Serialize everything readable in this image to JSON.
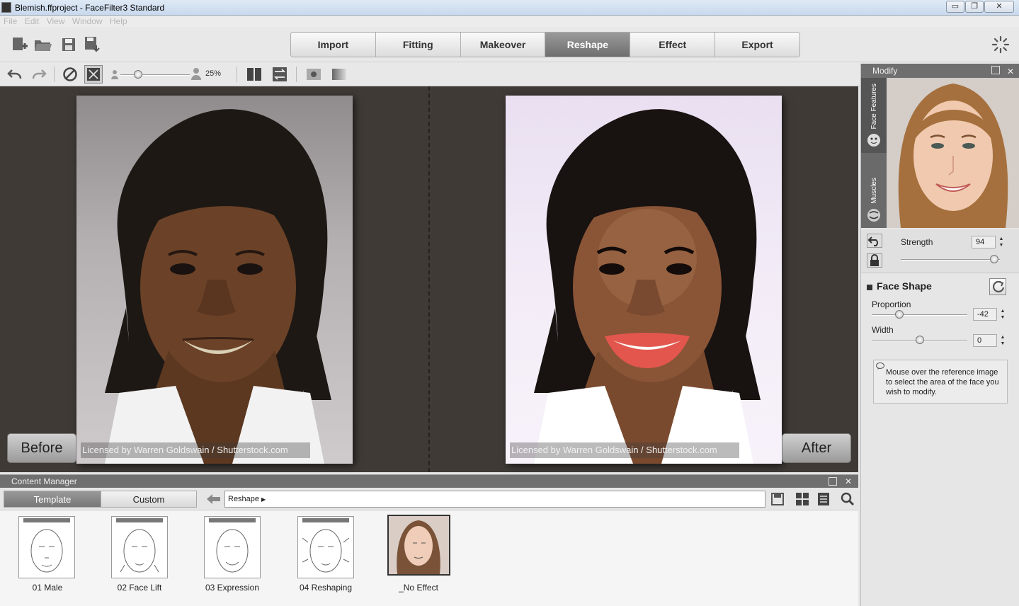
{
  "window": {
    "title": "Blemish.ffproject - FaceFilter3 Standard",
    "minimize": "▭",
    "restore": "❐",
    "close": "✕"
  },
  "menu": [
    "File",
    "Edit",
    "View",
    "Window",
    "Help"
  ],
  "tabs": [
    {
      "label": "Import"
    },
    {
      "label": "Fitting"
    },
    {
      "label": "Makeover"
    },
    {
      "label": "Reshape",
      "active": true
    },
    {
      "label": "Effect"
    },
    {
      "label": "Export"
    }
  ],
  "toolbar": {
    "zoom": "25%",
    "zoom_level": 0.25
  },
  "viewer": {
    "before_label": "Before",
    "after_label": "After",
    "watermark": "Licensed by Warren Goldswain / Shutterstock.com"
  },
  "modify": {
    "title": "Modify",
    "tab_face_features": "Face Features",
    "tab_muscles": "Muscles",
    "strength_label": "Strength",
    "strength_value": "94",
    "strength_level": 0.94
  },
  "face_shape": {
    "title": "Face Shape",
    "params": [
      {
        "label": "Proportion",
        "value": "-42",
        "level": 0.29
      },
      {
        "label": "Width",
        "value": "0",
        "level": 0.5
      }
    ],
    "hint": "Mouse over the reference image to select the area of the face you wish to modify."
  },
  "content_manager": {
    "title": "Content Manager",
    "tab_template": "Template",
    "tab_custom": "Custom",
    "path": "Reshape",
    "items": [
      "01 Male",
      "02 Face Lift",
      "03 Expression",
      "04 Reshaping",
      "_No Effect"
    ]
  },
  "colors": {
    "accent": "#7a7a7a",
    "viewer_bg": "#3f3a36"
  }
}
